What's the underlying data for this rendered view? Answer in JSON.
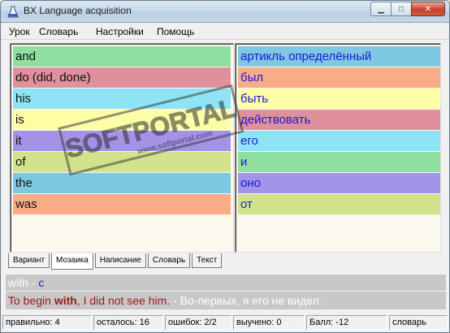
{
  "window": {
    "title": "BX Language acquisition",
    "buttons": {
      "minimize": "▁",
      "maximize": "□",
      "close": "✕"
    }
  },
  "menu": [
    "Урок",
    "Словарь",
    "Настройки",
    "Помощь"
  ],
  "left_words": [
    {
      "text": "and",
      "color": "#8fdfa0"
    },
    {
      "text": "do (did, done)",
      "color": "#e0909c"
    },
    {
      "text": "his",
      "color": "#8ee4f4"
    },
    {
      "text": "is",
      "color": "#fdfea6"
    },
    {
      "text": "it",
      "color": "#a393e6"
    },
    {
      "text": "of",
      "color": "#d3e28c"
    },
    {
      "text": "the",
      "color": "#7ec8e3"
    },
    {
      "text": "was",
      "color": "#f9ad86"
    }
  ],
  "right_words": [
    {
      "text": "артикль определённый",
      "color": "#7ec8e3"
    },
    {
      "text": "был",
      "color": "#f9ad86"
    },
    {
      "text": "быть",
      "color": "#fdfea6"
    },
    {
      "text": "действовать",
      "color": "#e0909c"
    },
    {
      "text": "его",
      "color": "#8ee4f4"
    },
    {
      "text": "и",
      "color": "#8fdfa0"
    },
    {
      "text": "оно",
      "color": "#a393e6"
    },
    {
      "text": "от",
      "color": "#d3e28c"
    }
  ],
  "watermark": {
    "main": "SOFTPORTAL",
    "sub": "www.softportal.com"
  },
  "tabs": [
    "Вариант",
    "Мозаика",
    "Написание",
    "Словарь",
    "Текст"
  ],
  "active_tab": 1,
  "hint": {
    "word": "with",
    "sep": " - ",
    "translation": "с"
  },
  "example": {
    "before": "To begin ",
    "bold": "with",
    "after": ", I did not see him.",
    "sep": " - ",
    "translation": "Во-первых, я его не видел."
  },
  "status": {
    "correct": "правильно: 4",
    "remaining": "осталось: 16",
    "errors": "ошибок: 2/2",
    "learned": "выучено: 0",
    "score": "Балл: -12",
    "mode": "словарь"
  }
}
